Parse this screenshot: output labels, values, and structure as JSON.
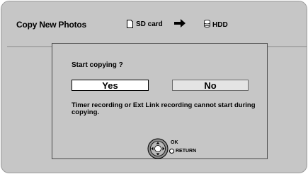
{
  "header": {
    "title": "Copy New Photos",
    "source_label": "SD card",
    "source_icon": "sd-card-icon",
    "direction_icon": "arrow-right-icon",
    "destination_label": "HDD",
    "destination_icon": "hdd-icon"
  },
  "dialog": {
    "prompt": "Start copying ?",
    "yes_label": "Yes",
    "no_label": "No",
    "note": "Timer recording or Ext Link recording cannot start during copying.",
    "selected_option": "Yes"
  },
  "controls": {
    "ok_label": "OK",
    "return_label": "RETURN",
    "nav_icon": "dpad-icon",
    "return_icon": "return-button-icon"
  }
}
